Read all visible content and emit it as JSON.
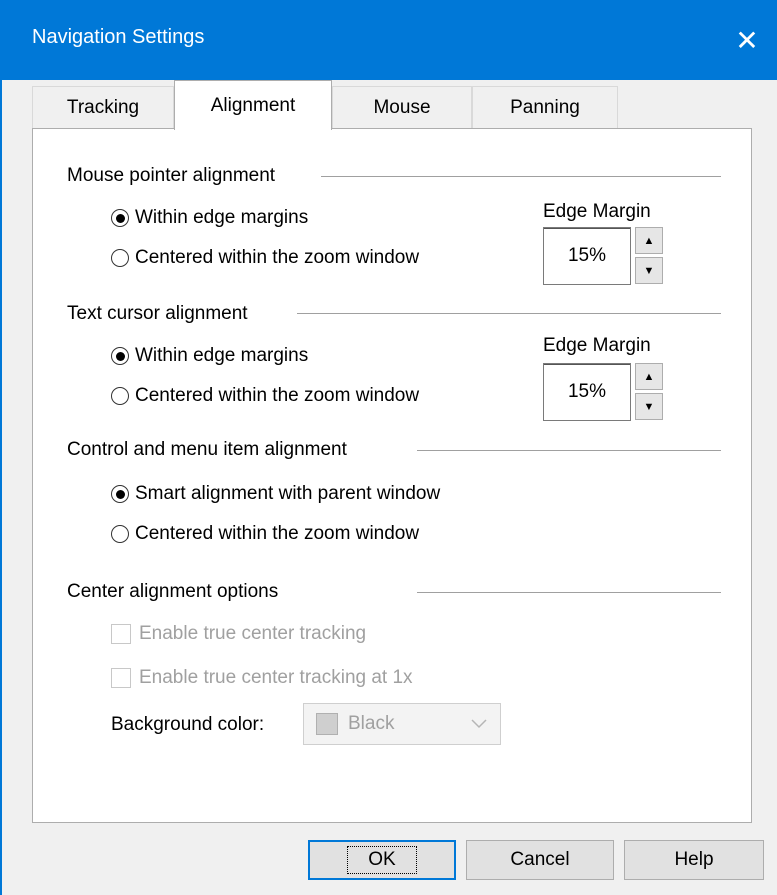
{
  "window": {
    "title": "Navigation Settings",
    "close_glyph": "✕"
  },
  "tabs": [
    {
      "label": "Tracking",
      "active": false
    },
    {
      "label": "Alignment",
      "active": true
    },
    {
      "label": "Mouse",
      "active": false
    },
    {
      "label": "Panning",
      "active": false
    }
  ],
  "mouse_pointer": {
    "title": "Mouse pointer alignment",
    "option1": "Within edge margins",
    "option2": "Centered within the zoom window",
    "selected": 1,
    "edge_label": "Edge Margin",
    "edge_value": "15%"
  },
  "text_cursor": {
    "title": "Text cursor alignment",
    "option1": "Within edge margins",
    "option2": "Centered within the zoom window",
    "selected": 1,
    "edge_label": "Edge Margin",
    "edge_value": "15%"
  },
  "control_menu": {
    "title": "Control and menu item alignment",
    "option1": "Smart alignment with parent window",
    "option2": "Centered within the zoom window",
    "selected": 1
  },
  "center_options": {
    "title": "Center alignment options",
    "check1": "Enable true center tracking",
    "check2": "Enable true center tracking at 1x",
    "bg_label": "Background color:",
    "bg_value": "Black"
  },
  "buttons": {
    "ok": "OK",
    "cancel": "Cancel",
    "help": "Help"
  },
  "spin_glyphs": {
    "up": "▲",
    "down": "▼"
  },
  "colors": {
    "accent": "#0078d7"
  }
}
